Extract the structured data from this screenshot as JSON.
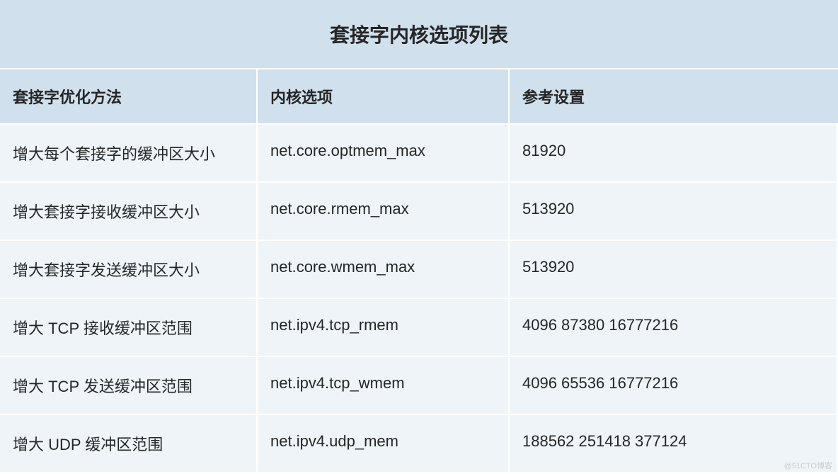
{
  "table": {
    "title": "套接字内核选项列表",
    "headers": {
      "col1": "套接字优化方法",
      "col2": "内核选项",
      "col3": "参考设置"
    },
    "rows": [
      {
        "method": "增大每个套接字的缓冲区大小",
        "option": "net.core.optmem_max",
        "value": "81920"
      },
      {
        "method": "增大套接字接收缓冲区大小",
        "option": "net.core.rmem_max",
        "value": "513920"
      },
      {
        "method": "增大套接字发送缓冲区大小",
        "option": "net.core.wmem_max",
        "value": "513920"
      },
      {
        "method": "增大 TCP 接收缓冲区范围",
        "option": "net.ipv4.tcp_rmem",
        "value": "4096 87380 16777216"
      },
      {
        "method": "增大 TCP 发送缓冲区范围",
        "option": "net.ipv4.tcp_wmem",
        "value": "4096 65536 16777216"
      },
      {
        "method": "增大 UDP 缓冲区范围",
        "option": "net.ipv4.udp_mem",
        "value": "188562 251418 377124"
      }
    ]
  },
  "watermark": "@51CTO博客"
}
